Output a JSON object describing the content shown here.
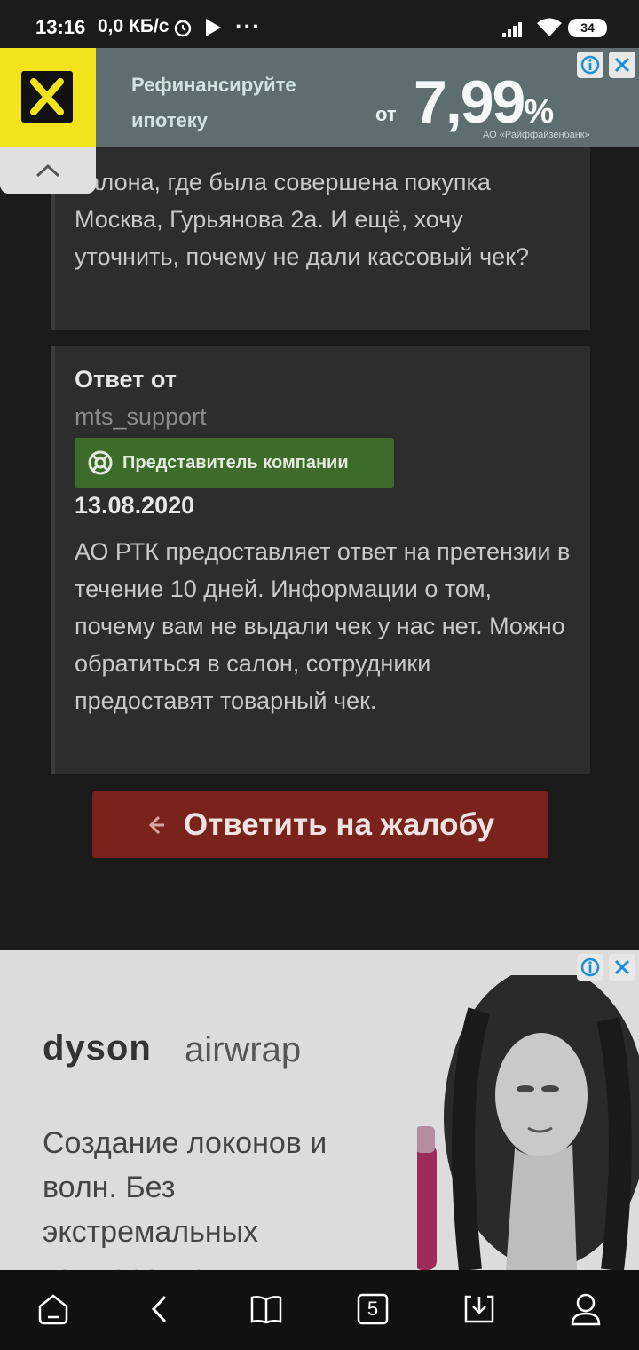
{
  "status_bar": {
    "time": "13:16",
    "speed": "0,0 КБ/с",
    "more": "···",
    "battery": "34"
  },
  "ad_top": {
    "line1": "Рефинансируйте",
    "line2": "ипотеку",
    "prefix": "от",
    "rate": "7,99",
    "percent": "%",
    "legal": "АО «Райффайзенбанк»",
    "info_icon": "info-icon",
    "close_icon": "close-icon",
    "brand_color": "#f2e31a"
  },
  "complaint_card": {
    "text": "салона, где была совершена покупка Москва, Гурьянова 2а. И ещё, хочу уточнить, почему не дали кассовый чек?"
  },
  "answer_card": {
    "from_label": "Ответ от",
    "username": "mts_support",
    "badge_label": "Представитель компании",
    "badge_color": "#3d6b2a",
    "date": "13.08.2020",
    "body": "АО РТК предоставляет ответ на претензии в течение 10 дней. Информации о том, почему вам не выдали чек у нас нет. Можно обратиться в салон, сотрудники предоставят товарный чек."
  },
  "reply_button": {
    "label": "Ответить на жалобу",
    "color": "#7a231c"
  },
  "ad_bottom": {
    "brand": "dyson",
    "product": "airwrap",
    "text": "Создание локонов и волн. Без экстремальных температур"
  },
  "nav": {
    "tabs_count": "5",
    "icons": [
      "home-icon",
      "back-icon",
      "bookmarks-icon",
      "tabs-icon",
      "downloads-icon",
      "profile-icon"
    ]
  }
}
